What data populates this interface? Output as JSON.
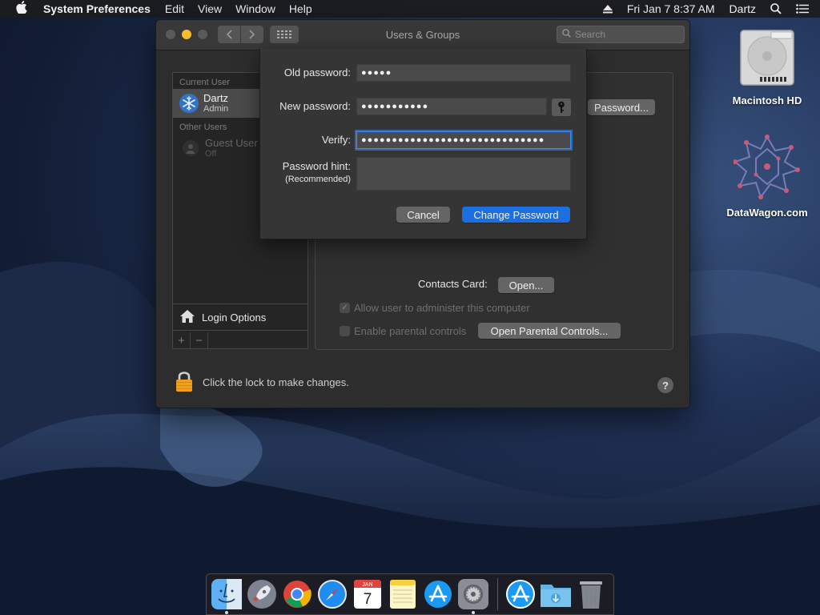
{
  "menubar": {
    "app_name": "System Preferences",
    "menus": [
      "Edit",
      "View",
      "Window",
      "Help"
    ],
    "clock": "Fri Jan 7  8:37 AM",
    "user": "Dartz"
  },
  "window": {
    "title": "Users & Groups",
    "search_placeholder": "Search"
  },
  "sidebar": {
    "current_header": "Current User",
    "current_user": {
      "name": "Dartz",
      "role": "Admin"
    },
    "other_header": "Other Users",
    "guest": {
      "name": "Guest User",
      "status": "Off"
    },
    "login_options": "Login Options",
    "add_label": "+",
    "remove_label": "−"
  },
  "panel": {
    "change_password_button": "Password...",
    "contacts_label": "Contacts Card:",
    "open_button": "Open...",
    "allow_admin_label": "Allow user to administer this computer",
    "allow_admin_checked": true,
    "parental_label": "Enable parental controls",
    "parental_checked": false,
    "open_parental_button": "Open Parental Controls..."
  },
  "lock": {
    "text": "Click the lock to make changes."
  },
  "help_label": "?",
  "sheet": {
    "old_password_label": "Old password:",
    "old_password_value": "●●●●●",
    "new_password_label": "New password:",
    "new_password_value": "●●●●●●●●●●●",
    "verify_label": "Verify:",
    "verify_value": "●●●●●●●●●●●●●●●●●●●●●●●●●●●●●●",
    "hint_label": "Password hint:",
    "hint_sublabel": "(Recommended)",
    "hint_value": "",
    "cancel_button": "Cancel",
    "change_button": "Change Password"
  },
  "desktop": {
    "icons": [
      {
        "label": "Macintosh HD",
        "icon": "hard-drive-icon"
      },
      {
        "label": "DataWagon.com",
        "icon": "datawagon-logo-icon"
      }
    ]
  },
  "dock": {
    "items": [
      "finder",
      "launchpad",
      "chrome",
      "safari",
      "calendar",
      "notes",
      "app-store",
      "system-preferences",
      "app-store-downloads",
      "downloads-folder",
      "trash"
    ],
    "calendar": {
      "month": "JAN",
      "day": "7"
    }
  },
  "colors": {
    "accent": "#1b6fe0",
    "focus_ring": "#3e8ef7"
  }
}
